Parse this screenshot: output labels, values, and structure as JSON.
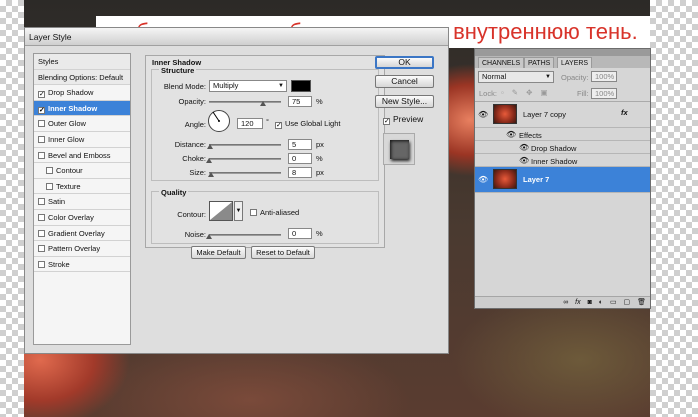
{
  "caption": "к обоим слоям добавляем тень и внутреннюю тень.",
  "dialog": {
    "title": "Layer Style",
    "styles_list": [
      {
        "label": "Styles",
        "type": "head"
      },
      {
        "label": "Blending Options: Default",
        "type": "head"
      },
      {
        "label": "Drop Shadow",
        "checked": true
      },
      {
        "label": "Inner Shadow",
        "checked": true,
        "selected": true
      },
      {
        "label": "Outer Glow",
        "checked": false
      },
      {
        "label": "Inner Glow",
        "checked": false
      },
      {
        "label": "Bevel and Emboss",
        "checked": false
      },
      {
        "label": "Contour",
        "checked": false,
        "indent": true
      },
      {
        "label": "Texture",
        "checked": false,
        "indent": true
      },
      {
        "label": "Satin",
        "checked": false
      },
      {
        "label": "Color Overlay",
        "checked": false
      },
      {
        "label": "Gradient Overlay",
        "checked": false
      },
      {
        "label": "Pattern Overlay",
        "checked": false
      },
      {
        "label": "Stroke",
        "checked": false
      }
    ],
    "section_title": "Inner Shadow",
    "structure_title": "Structure",
    "blend_mode_label": "Blend Mode:",
    "blend_mode_value": "Multiply",
    "shadow_color": "#000000",
    "opacity_label": "Opacity:",
    "opacity_value": "75",
    "opacity_unit": "%",
    "opacity_level": 0.75,
    "angle_label": "Angle:",
    "angle_value": "120",
    "angle_unit": "°",
    "use_global_light_label": "Use Global Light",
    "use_global_light_checked": true,
    "distance_label": "Distance:",
    "distance_value": "5",
    "distance_unit": "px",
    "distance_level": 0.02,
    "choke_label": "Choke:",
    "choke_value": "0",
    "choke_unit": "%",
    "choke_level": 0.0,
    "size_label": "Size:",
    "size_value": "8",
    "size_unit": "px",
    "size_level": 0.03,
    "quality_title": "Quality",
    "contour_label": "Contour:",
    "anti_aliased_label": "Anti-aliased",
    "anti_aliased_checked": false,
    "noise_label": "Noise:",
    "noise_value": "0",
    "noise_unit": "%",
    "noise_level": 0.0,
    "make_default_label": "Make Default",
    "reset_default_label": "Reset to Default",
    "ok_label": "OK",
    "cancel_label": "Cancel",
    "new_style_label": "New Style...",
    "preview_label": "Preview",
    "preview_checked": true
  },
  "layers_panel": {
    "tabs": [
      "CHANNELS",
      "PATHS",
      "LAYERS"
    ],
    "active_tab": "LAYERS",
    "blend_mode": "Normal",
    "opacity_label": "Opacity:",
    "opacity_value": "100%",
    "lock_label": "Lock:",
    "fill_label": "Fill:",
    "fill_value": "100%",
    "layers": [
      {
        "name": "Layer 7 copy",
        "fx": "fx",
        "selected": false,
        "effects_label": "Effects",
        "effects": [
          "Drop Shadow",
          "Inner Shadow"
        ]
      },
      {
        "name": "Layer 7",
        "selected": true
      }
    ],
    "footer_icons": [
      "link-icon",
      "fx-icon",
      "mask-icon",
      "adjustment-icon",
      "folder-icon",
      "new-layer-icon",
      "trash-icon"
    ]
  }
}
